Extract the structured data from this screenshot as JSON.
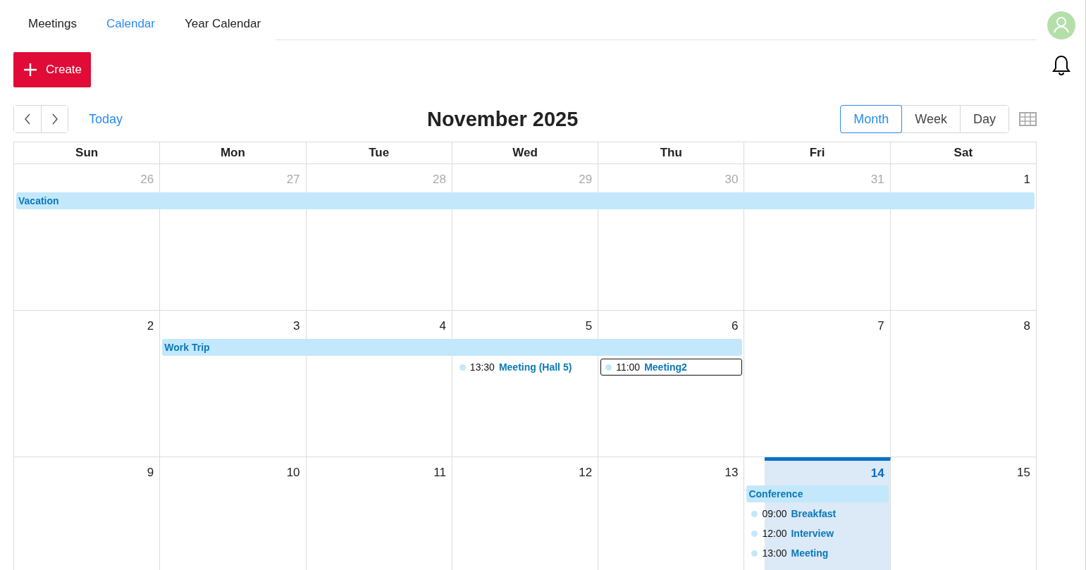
{
  "tabs": [
    {
      "label": "Meetings",
      "selected": false
    },
    {
      "label": "Calendar",
      "selected": true
    },
    {
      "label": "Year Calendar",
      "selected": false
    }
  ],
  "create_button": {
    "label": "Create"
  },
  "toolbar": {
    "today": "Today",
    "title": "November 2025",
    "views": [
      {
        "label": "Month",
        "selected": true
      },
      {
        "label": "Week",
        "selected": false
      },
      {
        "label": "Day",
        "selected": false
      }
    ]
  },
  "calendar": {
    "weekdays": [
      "Sun",
      "Mon",
      "Tue",
      "Wed",
      "Thu",
      "Fri",
      "Sat"
    ],
    "weeks": [
      {
        "days": [
          {
            "label": "26",
            "muted": true,
            "today": false,
            "events": [
              {
                "kind": "allday",
                "title": "Vacation"
              }
            ]
          },
          {
            "label": "27",
            "muted": true,
            "today": false,
            "events": [
              {
                "kind": "allday-cont"
              }
            ]
          },
          {
            "label": "28",
            "muted": true,
            "today": false,
            "events": [
              {
                "kind": "allday-cont"
              }
            ]
          },
          {
            "label": "29",
            "muted": true,
            "today": false,
            "events": [
              {
                "kind": "allday-cont"
              }
            ]
          },
          {
            "label": "30",
            "muted": true,
            "today": false,
            "events": [
              {
                "kind": "allday-cont"
              }
            ]
          },
          {
            "label": "31",
            "muted": true,
            "today": false,
            "events": [
              {
                "kind": "allday-cont"
              }
            ]
          },
          {
            "label": "1",
            "muted": false,
            "today": false,
            "events": [
              {
                "kind": "allday-cont"
              }
            ]
          }
        ]
      },
      {
        "days": [
          {
            "label": "2",
            "muted": false,
            "today": false
          },
          {
            "label": "3",
            "muted": false,
            "today": false,
            "events": [
              {
                "kind": "allday",
                "title": "Work Trip"
              }
            ]
          },
          {
            "label": "4",
            "muted": false,
            "today": false,
            "events": [
              {
                "kind": "allday-cont"
              }
            ]
          },
          {
            "label": "5",
            "muted": false,
            "today": false,
            "events": [
              {
                "kind": "allday-cont"
              },
              {
                "kind": "timed",
                "time": "13:30",
                "title": "Meeting (Hall 5)",
                "selected": false
              }
            ]
          },
          {
            "label": "6",
            "muted": false,
            "today": false,
            "events": [
              {
                "kind": "allday-cont"
              },
              {
                "kind": "timed",
                "time": "11:00",
                "title": "Meeting2",
                "selected": true
              }
            ]
          },
          {
            "label": "7",
            "muted": false,
            "today": false
          },
          {
            "label": "8",
            "muted": false,
            "today": false
          }
        ]
      },
      {
        "days": [
          {
            "label": "9",
            "muted": false,
            "today": false
          },
          {
            "label": "10",
            "muted": false,
            "today": false
          },
          {
            "label": "11",
            "muted": false,
            "today": false
          },
          {
            "label": "12",
            "muted": false,
            "today": false
          },
          {
            "label": "13",
            "muted": false,
            "today": false
          },
          {
            "label": "14",
            "muted": false,
            "today": true,
            "events": [
              {
                "kind": "allday",
                "title": "Conference"
              },
              {
                "kind": "timed",
                "time": "09:00",
                "title": "Breakfast",
                "selected": false
              },
              {
                "kind": "timed",
                "time": "12:00",
                "title": "Interview",
                "selected": false
              },
              {
                "kind": "timed",
                "time": "13:00",
                "title": "Meeting",
                "selected": false
              }
            ]
          },
          {
            "label": "15",
            "muted": false,
            "today": false
          }
        ]
      }
    ]
  }
}
